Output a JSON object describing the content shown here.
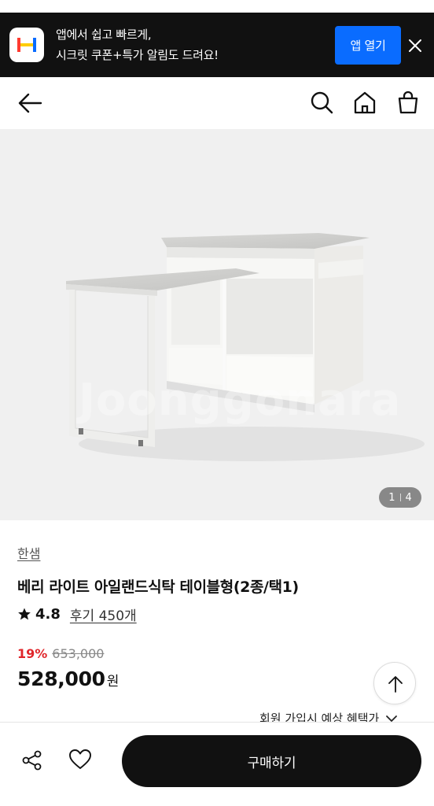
{
  "app_banner": {
    "line1": "앱에서 쉽고 빠르게,",
    "line2": "시크릿 쿠폰+특가 알림도 드려요!",
    "open_button": "앱 열기",
    "logo_colors": [
      "#ff3b30",
      "#ffcc00",
      "#0a6cff"
    ]
  },
  "nav": {
    "back_icon": "arrow-left-icon",
    "search_icon": "search-icon",
    "home_icon": "home-icon",
    "cart_icon": "shopping-bag-icon"
  },
  "image": {
    "current": "1",
    "total": "4",
    "watermark": "Joonggonara"
  },
  "product": {
    "brand": "한샘",
    "title": "베리 라이트 아일랜드식탁 테이블형(2종/택1)",
    "rating": "4.8",
    "review_label": "후기 450개",
    "discount_rate": "19%",
    "original_price": "653,000",
    "sale_price": "528,000",
    "currency": "원"
  },
  "benefit": {
    "label": "회원 가입시 예상 혜택가"
  },
  "bottom_bar": {
    "buy_label": "구매하기"
  },
  "colors": {
    "banner_bg": "#111111",
    "accent_blue": "#0a6cff",
    "discount_red": "#e0262b",
    "buy_button_bg": "#111111"
  }
}
